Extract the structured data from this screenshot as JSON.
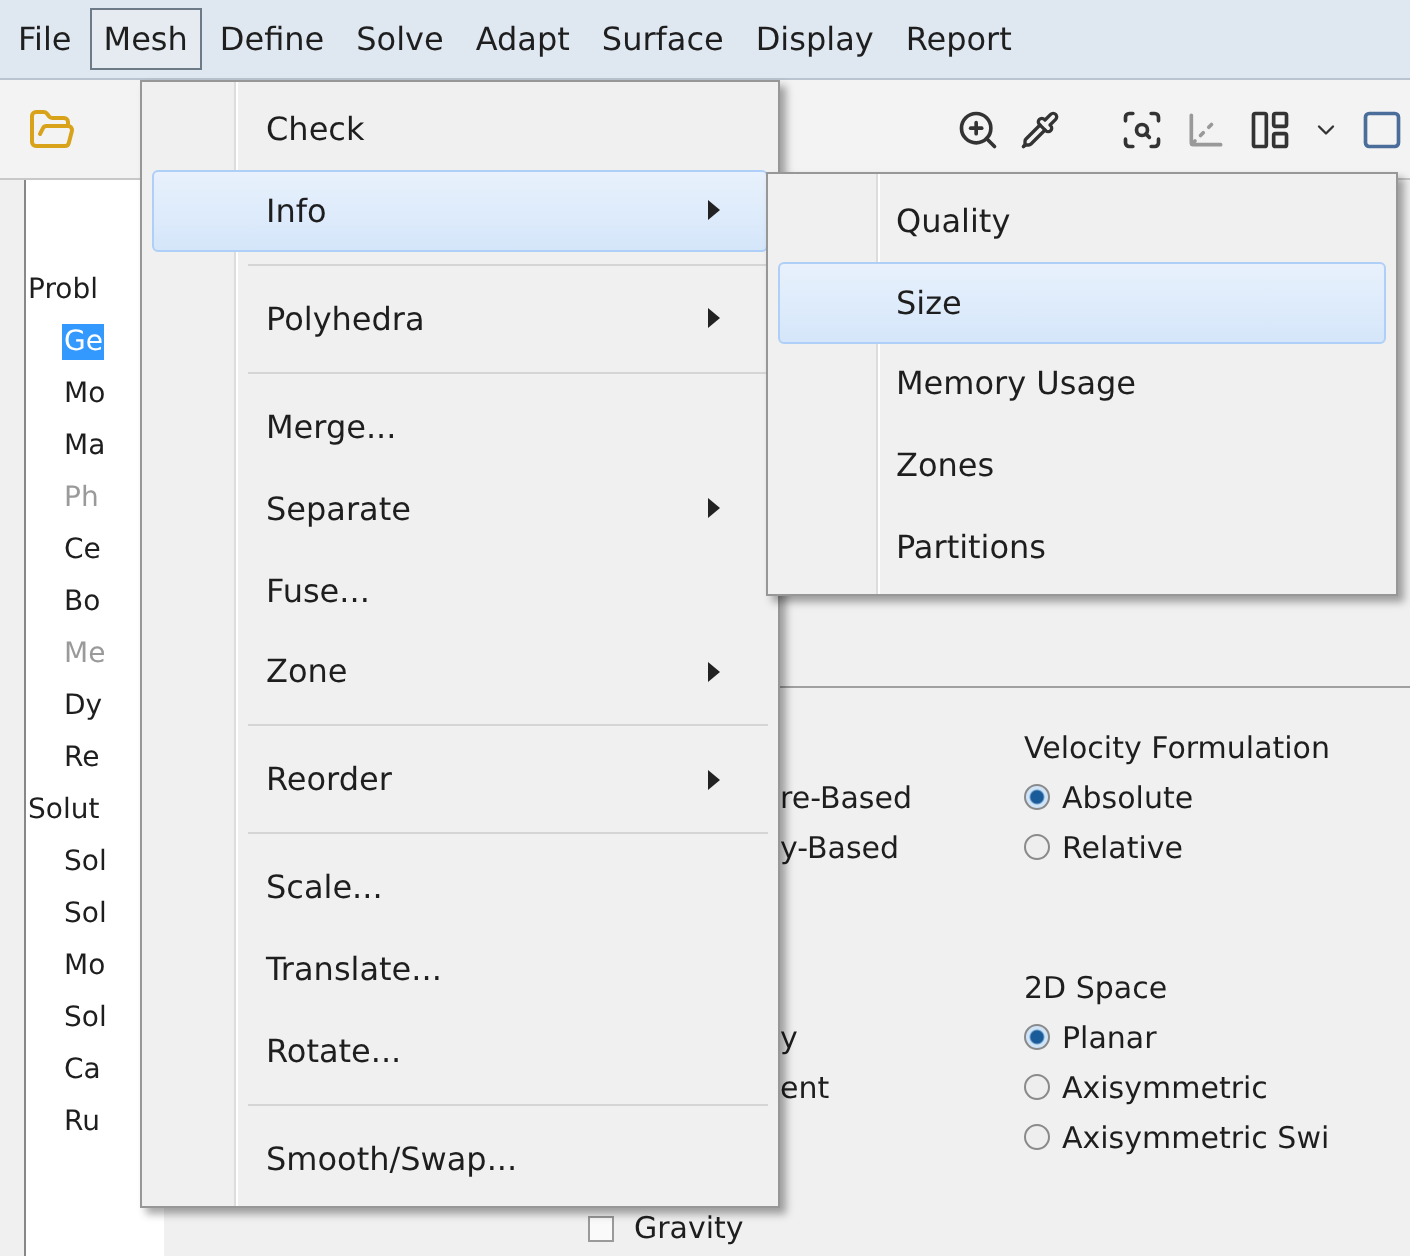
{
  "menubar": [
    {
      "label": "File",
      "selected": false
    },
    {
      "label": "Mesh",
      "selected": true
    },
    {
      "label": "Define",
      "selected": false
    },
    {
      "label": "Solve",
      "selected": false
    },
    {
      "label": "Adapt",
      "selected": false
    },
    {
      "label": "Surface",
      "selected": false
    },
    {
      "label": "Display",
      "selected": false
    },
    {
      "label": "Report",
      "selected": false
    }
  ],
  "tree": [
    {
      "label": "Probl",
      "selected": false,
      "disabled": false,
      "children": [
        {
          "label": "Ge",
          "selected": true,
          "disabled": false
        },
        {
          "label": "Mo",
          "selected": false,
          "disabled": false
        },
        {
          "label": "Ma",
          "selected": false,
          "disabled": false
        },
        {
          "label": "Ph",
          "selected": false,
          "disabled": true
        },
        {
          "label": "Ce",
          "selected": false,
          "disabled": false
        },
        {
          "label": "Bo",
          "selected": false,
          "disabled": false
        },
        {
          "label": "Me",
          "selected": false,
          "disabled": true
        },
        {
          "label": "Dy",
          "selected": false,
          "disabled": false
        },
        {
          "label": "Re",
          "selected": false,
          "disabled": false
        }
      ]
    },
    {
      "label": "Solut",
      "selected": false,
      "disabled": false,
      "children": [
        {
          "label": "Sol",
          "selected": false,
          "disabled": false
        },
        {
          "label": "Sol",
          "selected": false,
          "disabled": false
        },
        {
          "label": "Mo",
          "selected": false,
          "disabled": false
        },
        {
          "label": "Sol",
          "selected": false,
          "disabled": false
        },
        {
          "label": "Ca",
          "selected": false,
          "disabled": false
        },
        {
          "label": "Ru",
          "selected": false,
          "disabled": false
        }
      ]
    }
  ],
  "general_panel": {
    "type_options": [
      {
        "label": "re-Based"
      },
      {
        "label": "y-Based"
      }
    ],
    "time_options": [
      {
        "label": "y"
      },
      {
        "label": "ent"
      }
    ],
    "velocity_formulation": {
      "title": "Velocity Formulation",
      "options": [
        {
          "label": "Absolute",
          "selected": true
        },
        {
          "label": "Relative",
          "selected": false
        }
      ]
    },
    "space_2d": {
      "title": "2D Space",
      "options": [
        {
          "label": "Planar",
          "selected": true
        },
        {
          "label": "Axisymmetric",
          "selected": false
        },
        {
          "label": "Axisymmetric Swi",
          "selected": false
        }
      ]
    }
  },
  "gravity": {
    "label": "Gravity",
    "checked": false
  },
  "menu": {
    "groups": [
      [
        {
          "label": "Check",
          "submenu": false,
          "selected": false
        },
        {
          "label": "Info",
          "submenu": true,
          "selected": true
        }
      ],
      [
        {
          "label": "Polyhedra",
          "submenu": true,
          "selected": false
        }
      ],
      [
        {
          "label": "Merge...",
          "submenu": false,
          "selected": false
        },
        {
          "label": "Separate",
          "submenu": true,
          "selected": false
        },
        {
          "label": "Fuse...",
          "submenu": false,
          "selected": false
        },
        {
          "label": "Zone",
          "submenu": true,
          "selected": false
        }
      ],
      [
        {
          "label": "Reorder",
          "submenu": true,
          "selected": false
        }
      ],
      [
        {
          "label": "Scale...",
          "submenu": false,
          "selected": false
        },
        {
          "label": "Translate...",
          "submenu": false,
          "selected": false
        },
        {
          "label": "Rotate...",
          "submenu": false,
          "selected": false
        }
      ],
      [
        {
          "label": "Smooth/Swap...",
          "submenu": false,
          "selected": false
        }
      ]
    ]
  },
  "submenu": {
    "items": [
      {
        "label": "Quality",
        "selected": false
      },
      {
        "label": "Size",
        "selected": true
      },
      {
        "label": "Memory Usage",
        "selected": false
      },
      {
        "label": "Zones",
        "selected": false
      },
      {
        "label": "Partitions",
        "selected": false
      }
    ]
  }
}
